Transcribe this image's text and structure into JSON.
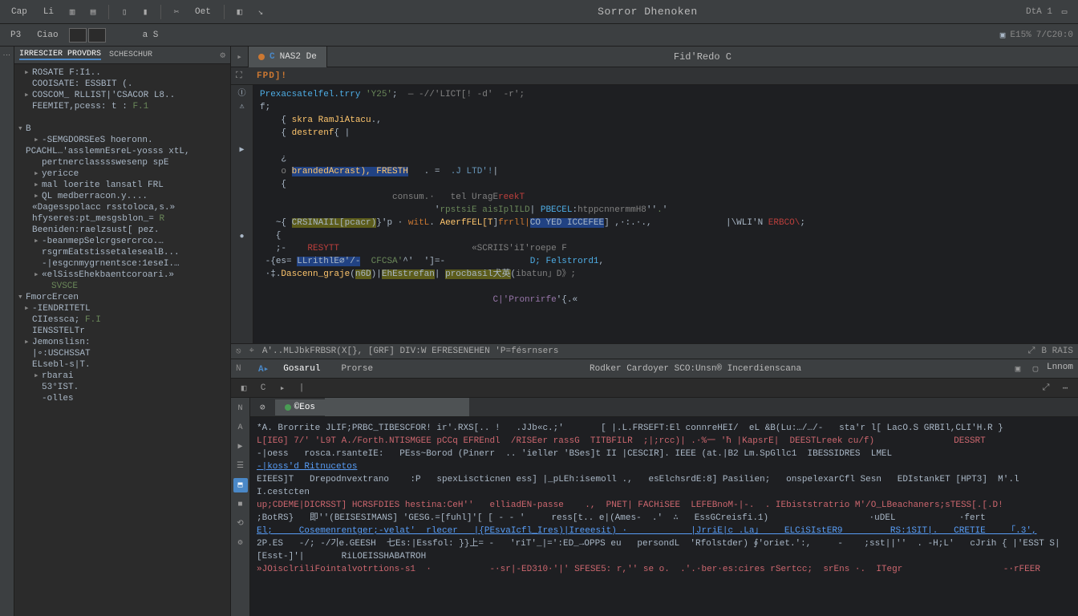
{
  "menubar": {
    "items": [
      "Cap",
      "Li",
      "Oet"
    ],
    "title": "Sorror Dhenoken",
    "right_meta": "DtA 1"
  },
  "toolbar": {
    "btn_pkg": "P3",
    "btn_class": "Ciao",
    "crumb": "a S",
    "right_badge": "E15%",
    "right_pos": "7/C20:0"
  },
  "project_panel": {
    "tabs": [
      "IRRESCIER PROVDRS",
      "SCHESCHUR"
    ],
    "tree": [
      {
        "d": 1,
        "a": "▸",
        "t": "ROSATE  F:I1..",
        "c": ""
      },
      {
        "d": 1,
        "a": " ",
        "t": "COOISATE:  ESSBIT (.",
        "c": ""
      },
      {
        "d": 1,
        "a": "▸",
        "t": "COSCOM_ RLLIST|'CSACOR L8..",
        "c": ""
      },
      {
        "d": 1,
        "a": " ",
        "t": "FEEMIET,pcess: t :",
        "c": "F.1"
      },
      {
        "d": 1,
        "a": " ",
        "t": "",
        "c": ""
      },
      {
        "d": 0,
        "a": "▾",
        "t": "B",
        "c": ""
      },
      {
        "d": 2,
        "a": "▸",
        "t": "-SEMGDORSEeS hoeronn.",
        "c": ""
      },
      {
        "d": 0,
        "a": " ",
        "t": "PCACHL…'asslemnEsreL-yosss  xtL,",
        "c": ""
      },
      {
        "d": 2,
        "a": " ",
        "t": "pertnerclasssswesenp spE",
        "c": ""
      },
      {
        "d": 2,
        "a": "▸",
        "t": "yericce",
        "c": ""
      },
      {
        "d": 2,
        "a": "▸",
        "t": "mal loerite lansatl FRL",
        "c": ""
      },
      {
        "d": 2,
        "a": "▸",
        "t": "QL  medberracon.y....",
        "c": ""
      },
      {
        "d": 1,
        "a": " ",
        "t": "«Dagesspolacc rsstoloca,s.»",
        "c": ""
      },
      {
        "d": 1,
        "a": " ",
        "t": "hfyseres:pt_mesgsblon_=",
        "c": "R"
      },
      {
        "d": 1,
        "a": " ",
        "t": "Beeniden:raelzsust[ pez.",
        "c": ""
      },
      {
        "d": 2,
        "a": "▸",
        "t": "-beanmepSelcrgsercrco.…",
        "c": ""
      },
      {
        "d": 2,
        "a": " ",
        "t": "rsgrmEatstissetalesealB...",
        "c": ""
      },
      {
        "d": 2,
        "a": " ",
        "t": "-|esgcnmygrnentsce:1eseI.…",
        "c": ""
      },
      {
        "d": 2,
        "a": "▸",
        "t": "«elSissEhekbaentcoroari.»",
        "c": ""
      },
      {
        "d": 3,
        "a": " ",
        "t": "SVSCE",
        "c": "annot"
      },
      {
        "d": 0,
        "a": "▾",
        "t": "FmorcErcen",
        "c": ""
      },
      {
        "d": 1,
        "a": "▸",
        "t": "-IENDRITETL",
        "c": ""
      },
      {
        "d": 1,
        "a": " ",
        "t": "CIIessca;",
        "c": "F.I"
      },
      {
        "d": 1,
        "a": " ",
        "t": "IENSSTELTr",
        "c": ""
      },
      {
        "d": 1,
        "a": "▸",
        "t": "Jemonslisn:",
        "c": ""
      },
      {
        "d": 1,
        "a": " ",
        "t": "|∘:USCHSSAT",
        "c": ""
      },
      {
        "d": 1,
        "a": " ",
        "t": "ELsebl-s|T.",
        "c": ""
      },
      {
        "d": 2,
        "a": "▸",
        "t": "rbarai",
        "c": ""
      },
      {
        "d": 2,
        "a": " ",
        "t": "53°IST.",
        "c": ""
      },
      {
        "d": 2,
        "a": " ",
        "t": "-olles",
        "c": ""
      }
    ]
  },
  "editor": {
    "tab_label": "NAS2 De",
    "tab_title_right": "Fid'Redo C",
    "decl": "FPD]!",
    "lines": [
      {
        "raw": "<span class='mac'>Prexacsatelfel.trry</span> <span class='str'>'Y25'</span>;  <span class='cm'>— -//'LICT[! -d'  -r';</span>"
      },
      {
        "raw": "<span class='op'>f;</span>"
      },
      {
        "raw": "    { <span class='fn'>skra RamJiAtacu</span>.,"
      },
      {
        "raw": "    { <span class='fn'>destrenf</span>{ |"
      },
      {
        "raw": ""
      },
      {
        "raw": "    <span class='op'>¿</span>"
      },
      {
        "raw": "    <span class='cm'>o</span> <span class='hl-g'><span class='fn'>brandedAcrast), FRESTH</span></span>   <span class='op'>. =</span>  <span class='num'>.J LTD'!</span>|"
      },
      {
        "raw": "    {"
      },
      {
        "raw": "                         <span class='cm'>consum.·   tel UragE</span><span class='err'>reekT</span>"
      },
      {
        "raw": "                                 '<span class='str'>rpstsiE aisIplILD</span>| <span class='mac'>PBECEL</span>:<span class='cm'>htppcnnermmH8</span>''<span class='str'>.</span>'"
      },
      {
        "raw": "   <span class='op'>~{</span> <span class='hl-y'>CRSINAIIL[pcacr)</span>}'<span class='op'>p</span> · <span class='kw'>witL</span>. <span class='fn'>AeerfFEL[T</span>]<span class='kw'>frrll|</span><span class='hl-g'>CO YED ICCEFEE</span>] ,·:.·.,              |\\WLI'N <span class='err'>ERBCO\\</span>;"
      },
      {
        "raw": "   {"
      },
      {
        "raw": "   <span class='op'>;-</span>    <span class='err'>RESYTT</span>                         <span class='cm'>«SCRIIS'iI'roepe F</span>"
      },
      {
        "raw": " <span class='op'>-{</span>es= <span class='hl-g'>LLrithlE∅'/-</span>  <span class='str'>CFCSA'</span>^'  ']=-                <span class='mac'>D; Felstrord1</span>,"
      },
      {
        "raw": " <span class='op'>·‡</span>.<span class='fn'>Dascenn_graje</span>(<span class='hl-y'>n6D</span>)|<span class='hl-y'>EhEstrefan</span>| <span class='hl-y'>procbasil犬英</span>(<span class='cm'>ibatun」D》;</span>"
      },
      {
        "raw": ""
      },
      {
        "raw": "                                            <span class='lit'>C|'Pronrirfe</span>'{.«"
      }
    ],
    "gutter_markers": [
      "Ⓘ",
      "⚠",
      "",
      "",
      "▶",
      "",
      "",
      "",
      "",
      "",
      "●",
      "",
      "",
      "",
      "",
      "",
      ""
    ]
  },
  "status_strip": {
    "breadcrumb": "A'..MLJbkFRBSR(X[},  [GRF]  DIV:W   EFRESENEHEN 'P=fésrnsers",
    "right_items": [
      "⤢",
      "B RAIS"
    ]
  },
  "bottom_panel": {
    "tabs": [
      "Gosarul",
      "Prorse"
    ],
    "title": "Rodker Cardoyer  SCO:Unsn®  Incerdienscana",
    "right_tab": "Lnnom",
    "toolbar_icons": [
      "◧",
      "C",
      "▸",
      "|"
    ],
    "left_rail": [
      "N",
      "A",
      "▶",
      "☰",
      "⬒",
      "■",
      "⟲",
      "⚙"
    ],
    "sub_tab": "©Eos",
    "console_lines": [
      {
        "cls": "",
        "t": "*A. Brorrite JLIF;PRBC_TIBESCFOR! ir'.RXS[.. !   .JJb«c.;'       [ |.L.FRSEFT:El connreHEI/  eL &B(Lu:…/…/-   sta'r l[ LacO.S GRBIl,CLI'H.R }"
      },
      {
        "cls": "c-err",
        "t": "L[IEG] 7/' 'L9T A./Forth.NTISMGEE pCCq EFREndl  /RISEer rassG  TITBFILR  ;|;rcc)| .·%一 'ħ |KapsrE|  DEESTLreek cu/f)               DESSRT"
      },
      {
        "cls": "",
        "t": "-|oess   rosca.rsanteIE:   PEss~Borod (Pinerr  .. 'ieller 'BSes]t II |CESCIR]. IEEE (at.|B2 Lm.SpGllc1  IBESSIDRES  LMEL"
      },
      {
        "cls": "c-link",
        "t": "-|koss'd Ritnucetos"
      },
      {
        "cls": "",
        "t": ""
      },
      {
        "cls": "",
        "t": "EIEES]T   Drepodnvextrano    :P   spexLiscticnen ess] |_pLEh:isemoll .,   esElchsrdE:8] Pasilien;   onspelexarCfl Sesn   EDIstankET [HPT3]  M'.l I.cestcten"
      },
      {
        "cls": "c-err",
        "t": "up;CDEME|DICRSST] HCRSFDIES hestina:CeH''   elliadEN-passe    .,  PNET| FACHiSEE  LEFEBnoM-|-.  . IEbiststratrio M'/O_LBeachaners;sTESS[.[.D!"
      },
      {
        "cls": "",
        "t": ";BotRS}   即''(BEISESIMANS] 'GESG.=[fuhl]'[ [ - - '     ress[t.. e|(Ames-  .'  ∴   EssGCreisfi.1)                   ·uDEL            ·fert"
      },
      {
        "cls": "c-link",
        "t": "El;     Cosemenrentger;-velat'  rlecer   |{PEsvaIcfl_Ires)|Ireeesit) ·            |JrriE|c .La」    ELCiSIstER9         RS:1SIT|.   CRETIE    「.3',"
      },
      {
        "cls": "",
        "t": "2P.ES   -/; -/기e.GEESH  七Es:|Essfol: }}上= -   'riT'_|=':ED_→OPPS eu   persondL  'Rfolstder) ∮'oriet.':,     -    ;sst||''  . -H;L'   cJrih { |'ESST S|"
      },
      {
        "cls": "",
        "t": "[Esst-]'|       RiLOEISSHABATROH"
      },
      {
        "cls": "c-err",
        "t": "»JOisclriliFointalvotrtions-s1  ·           -·sr|-ED310·'|' SFESE5: r,'' se o.  .'.·ber·es:cires rSertcc;  srEns ·.  ITegr                   -·rFEER"
      }
    ]
  }
}
